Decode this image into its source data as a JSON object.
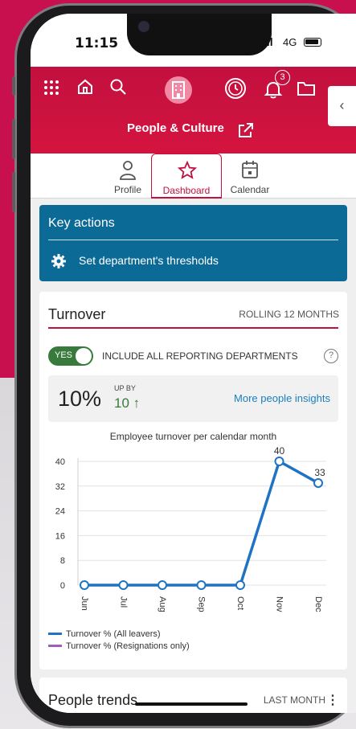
{
  "status_bar": {
    "time": "11:15",
    "signal": "ıll",
    "network": "4G"
  },
  "header": {
    "title": "People & Culture",
    "notification_count": "3",
    "collapse_glyph": "‹",
    "icons": [
      "grid-icon",
      "home-icon",
      "search-icon",
      "building-icon",
      "clock-icon",
      "bell-icon",
      "folder-icon",
      "external-link-icon"
    ]
  },
  "tabs": [
    {
      "label": "Profile",
      "icon": "person-icon",
      "active": false
    },
    {
      "label": "Dashboard",
      "icon": "star-icon",
      "active": true
    },
    {
      "label": "Calendar",
      "icon": "calendar-icon",
      "active": false
    }
  ],
  "key_actions": {
    "title": "Key actions",
    "items": [
      {
        "label": "Set department's thresholds",
        "icon": "gear-icon"
      }
    ]
  },
  "turnover": {
    "title": "Turnover",
    "period": "ROLLING 12 MONTHS",
    "toggle_label": "YES",
    "toggle_on": true,
    "include_label": "INCLUDE ALL REPORTING DEPARTMENTS",
    "help": "?",
    "stat_value": "10%",
    "stat_upby": "UP BY",
    "stat_change": "10 ↑",
    "link": "More people insights"
  },
  "chart_data": {
    "type": "line",
    "title": "Employee turnover per calendar month",
    "categories": [
      "Jun",
      "Jul",
      "Aug",
      "Sep",
      "Oct",
      "Nov",
      "Dec"
    ],
    "series": [
      {
        "name": "Turnover % (All leavers)",
        "color": "#1f73c4",
        "values": [
          0,
          0,
          0,
          0,
          0,
          40,
          33
        ]
      },
      {
        "name": "Turnover % (Resignations only)",
        "color": "#9b5fc4",
        "values": []
      }
    ],
    "data_labels": [
      "",
      "",
      "",
      "",
      "",
      "40",
      "33"
    ],
    "yticks": [
      0,
      8,
      16,
      24,
      32,
      40
    ],
    "ylim": [
      0,
      40
    ],
    "grid": true
  },
  "people_trends": {
    "title": "People trends",
    "period": "LAST MONTH",
    "menu": "⋮"
  },
  "colors": {
    "brand": "#c3103f",
    "key_actions_bg": "#0c6b96",
    "positive": "#387a3c",
    "link": "#1a7fbd"
  }
}
